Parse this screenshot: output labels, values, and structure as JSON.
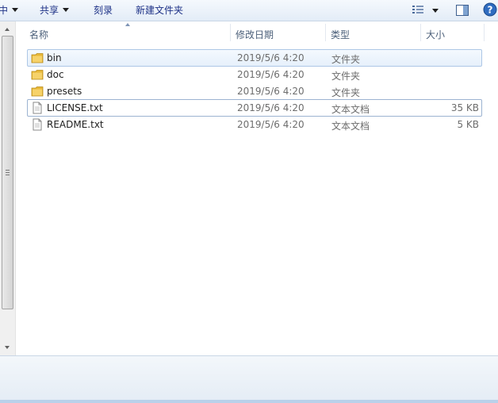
{
  "toolbar": {
    "partial_label": "中",
    "share_label": "共享",
    "burn_label": "刻录",
    "new_folder_label": "新建文件夹",
    "help_glyph": "?"
  },
  "columns": {
    "name": "名称",
    "date": "修改日期",
    "type": "类型",
    "size": "大小"
  },
  "files": [
    {
      "name": "bin",
      "date": "2019/5/6 4:20",
      "type": "文件夹",
      "size": "",
      "kind": "folder",
      "selected": true
    },
    {
      "name": "doc",
      "date": "2019/5/6 4:20",
      "type": "文件夹",
      "size": "",
      "kind": "folder"
    },
    {
      "name": "presets",
      "date": "2019/5/6 4:20",
      "type": "文件夹",
      "size": "",
      "kind": "folder"
    },
    {
      "name": "LICENSE.txt",
      "date": "2019/5/6 4:20",
      "type": "文本文档",
      "size": "35 KB",
      "kind": "file",
      "focused": true
    },
    {
      "name": "README.txt",
      "date": "2019/5/6 4:20",
      "type": "文本文档",
      "size": "5 KB",
      "kind": "file"
    }
  ],
  "colors": {
    "selection_border": "#adc7e6",
    "toolbar_text": "#1e3287",
    "folder_yellow": "#e8b838"
  }
}
